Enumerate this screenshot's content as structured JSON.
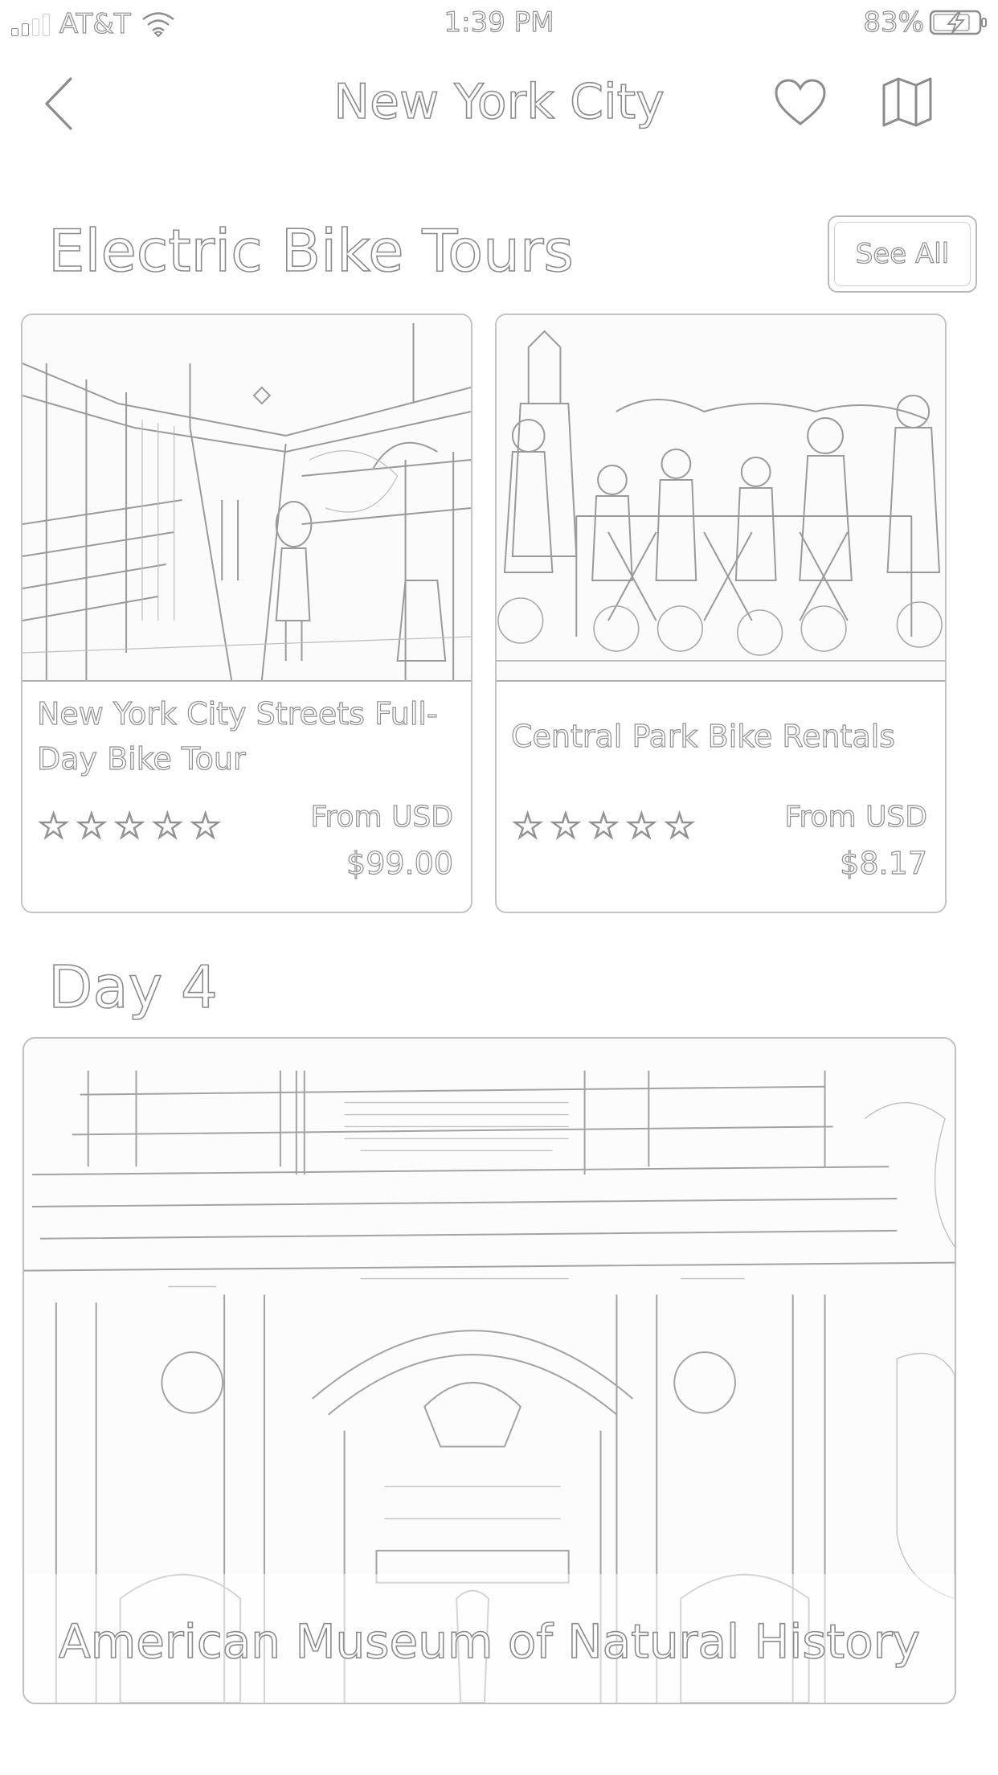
{
  "status_bar": {
    "carrier": "AT&T",
    "time": "1:39 PM",
    "battery": "83%"
  },
  "nav": {
    "title": "New York City",
    "back_icon": "chevron-left-icon",
    "favorite_icon": "heart-icon",
    "map_icon": "map-icon"
  },
  "sections": [
    {
      "title": "Electric Bike Tours",
      "see_all_label": "See All",
      "cards": [
        {
          "title": "New York City Streets Full-Day Bike Tour",
          "rating": 0,
          "stars": [
            "☆",
            "☆",
            "☆",
            "☆",
            "☆"
          ],
          "from_label": "From USD",
          "price": "$99.00"
        },
        {
          "title": "Central Park Bike Rentals",
          "rating": 0,
          "stars": [
            "☆",
            "☆",
            "☆",
            "☆",
            "☆"
          ],
          "from_label": "From USD",
          "price": "$8.17"
        }
      ]
    },
    {
      "title": "Day 4",
      "feature": {
        "title": "American Museum of Natural History"
      }
    }
  ],
  "colors": {
    "outline": "#8c8c8c",
    "border": "#c4c4c4",
    "background": "#ffffff"
  }
}
